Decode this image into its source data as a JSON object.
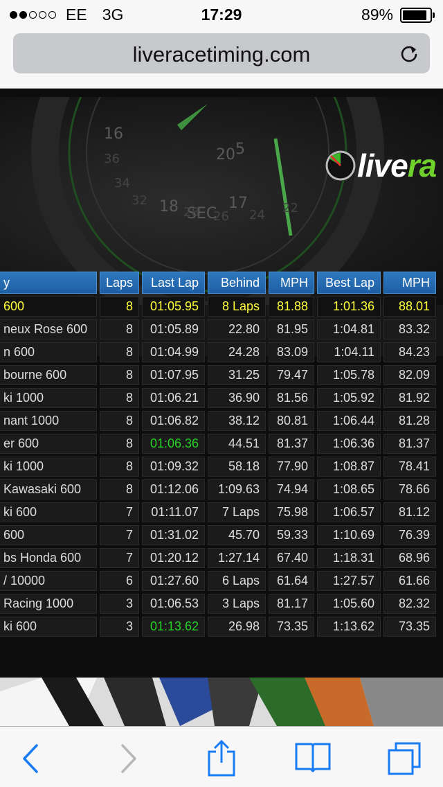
{
  "status": {
    "carrier": "EE",
    "network": "3G",
    "time": "17:29",
    "battery": "89%",
    "battery_level": 0.89,
    "signal_bars": 2
  },
  "address_bar": {
    "url": "liveracetiming.com"
  },
  "logo": {
    "text_white": "live",
    "text_green": "ra"
  },
  "table": {
    "headers": [
      "y",
      "Laps",
      "Last Lap",
      "Behind",
      "MPH",
      "Best Lap",
      "MPH"
    ],
    "rows": [
      {
        "name": "600",
        "laps": "8",
        "last_lap": "01:05.95",
        "behind": "8 Laps",
        "mph": "81.88",
        "best_lap": "1:01.36",
        "best_mph": "88.01",
        "leader": true
      },
      {
        "name": "neux Rose 600",
        "laps": "8",
        "last_lap": "01:05.89",
        "behind": "22.80",
        "mph": "81.95",
        "best_lap": "1:04.81",
        "best_mph": "83.32"
      },
      {
        "name": "n 600",
        "laps": "8",
        "last_lap": "01:04.99",
        "behind": "24.28",
        "mph": "83.09",
        "best_lap": "1:04.11",
        "best_mph": "84.23"
      },
      {
        "name": "bourne 600",
        "laps": "8",
        "last_lap": "01:07.95",
        "behind": "31.25",
        "mph": "79.47",
        "best_lap": "1:05.78",
        "best_mph": "82.09"
      },
      {
        "name": "ki 1000",
        "laps": "8",
        "last_lap": "01:06.21",
        "behind": "36.90",
        "mph": "81.56",
        "best_lap": "1:05.92",
        "best_mph": "81.92"
      },
      {
        "name": "nant 1000",
        "laps": "8",
        "last_lap": "01:06.82",
        "behind": "38.12",
        "mph": "80.81",
        "best_lap": "1:06.44",
        "best_mph": "81.28"
      },
      {
        "name": "er 600",
        "laps": "8",
        "last_lap": "01:06.36",
        "behind": "44.51",
        "mph": "81.37",
        "best_lap": "1:06.36",
        "best_mph": "81.37",
        "best": true
      },
      {
        "name": "ki 1000",
        "laps": "8",
        "last_lap": "01:09.32",
        "behind": "58.18",
        "mph": "77.90",
        "best_lap": "1:08.87",
        "best_mph": "78.41"
      },
      {
        "name": "Kawasaki 600",
        "laps": "8",
        "last_lap": "01:12.06",
        "behind": "1:09.63",
        "mph": "74.94",
        "best_lap": "1:08.65",
        "best_mph": "78.66"
      },
      {
        "name": "ki 600",
        "laps": "7",
        "last_lap": "01:11.07",
        "behind": "7 Laps",
        "mph": "75.98",
        "best_lap": "1:06.57",
        "best_mph": "81.12"
      },
      {
        "name": "600",
        "laps": "7",
        "last_lap": "01:31.02",
        "behind": "45.70",
        "mph": "59.33",
        "best_lap": "1:10.69",
        "best_mph": "76.39"
      },
      {
        "name": "bs Honda 600",
        "laps": "7",
        "last_lap": "01:20.12",
        "behind": "1:27.14",
        "mph": "67.40",
        "best_lap": "1:18.31",
        "best_mph": "68.96"
      },
      {
        "name": "/ 10000",
        "laps": "6",
        "last_lap": "01:27.60",
        "behind": "6 Laps",
        "mph": "61.64",
        "best_lap": "1:27.57",
        "best_mph": "61.66"
      },
      {
        "name": "Racing 1000",
        "laps": "3",
        "last_lap": "01:06.53",
        "behind": "3 Laps",
        "mph": "81.17",
        "best_lap": "1:05.60",
        "best_mph": "82.32"
      },
      {
        "name": "ki 600",
        "laps": "3",
        "last_lap": "01:13.62",
        "behind": "26.98",
        "mph": "73.35",
        "best_lap": "1:13.62",
        "best_mph": "73.35",
        "best": true
      }
    ]
  },
  "toolbar": {
    "back": "back-icon",
    "forward": "forward-icon",
    "share": "share-icon",
    "bookmarks": "bookmarks-icon",
    "tabs": "tabs-icon"
  },
  "colors": {
    "leader_text": "#ffff3a",
    "personal_best": "#27d127",
    "header_blue": "#1e5fa3",
    "ios_blue": "#1a7cf5"
  }
}
